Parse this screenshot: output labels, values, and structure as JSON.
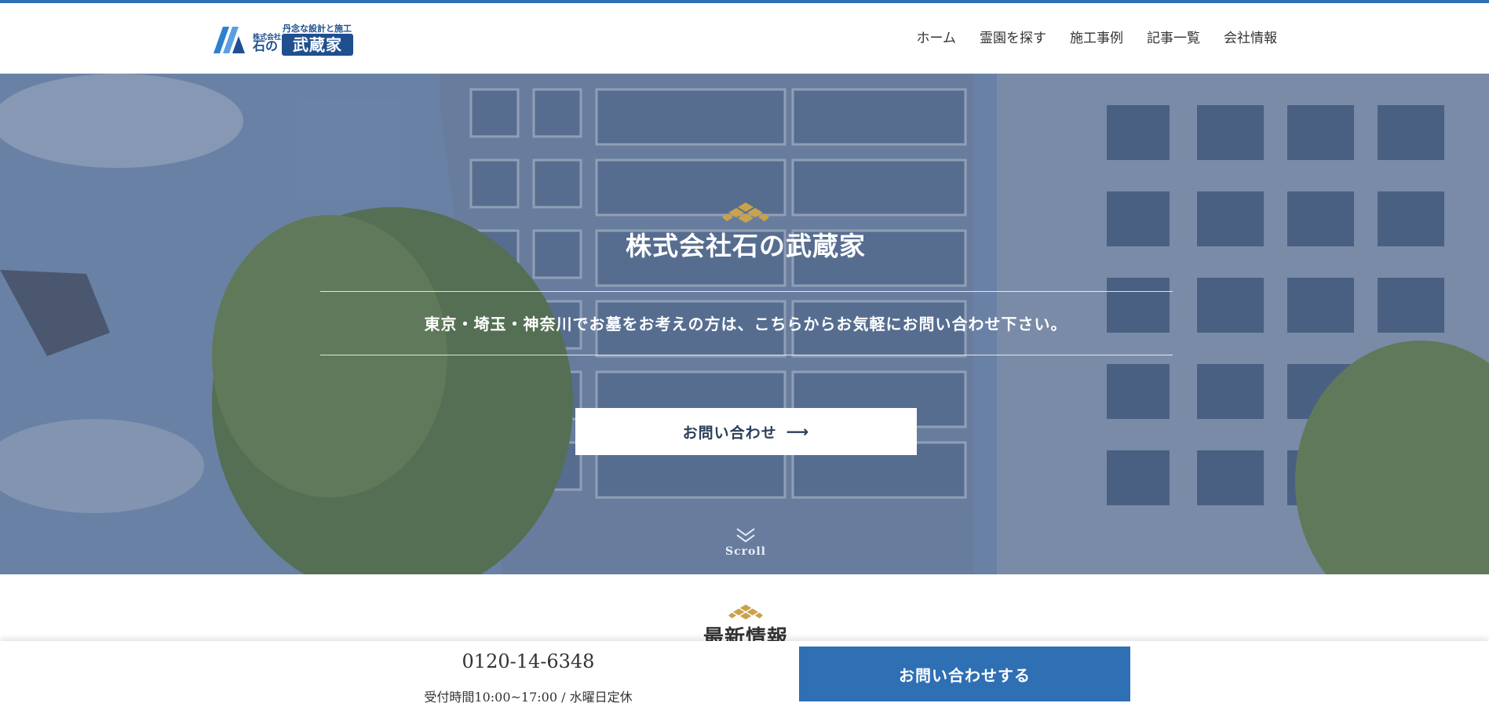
{
  "brand": {
    "tagline": "丹念な設計と施工",
    "company_prefix": "株式会社",
    "name_part1": "石の",
    "name_part2": "武蔵家"
  },
  "nav": {
    "items": [
      "ホーム",
      "霊園を探す",
      "施工事例",
      "記事一覧",
      "会社情報"
    ]
  },
  "hero": {
    "title": "株式会社石の武蔵家",
    "subtitle": "東京・埼玉・神奈川でお墓をお考えの方は、こちらからお気軽にお問い合わせ下さい。",
    "button_label": "お問い合わせ",
    "button_arrow": "⟶",
    "scroll_label": "Scroll"
  },
  "news": {
    "title": "最新情報"
  },
  "footer": {
    "phone": "0120-14-6348",
    "hours": "受付時間10:00~17:00 / 水曜日定休",
    "contact_button": "お問い合わせする"
  },
  "colors": {
    "accent": "#2f6fb3",
    "brand_navy": "#1f4f8f",
    "gold": "#c9a24a"
  }
}
